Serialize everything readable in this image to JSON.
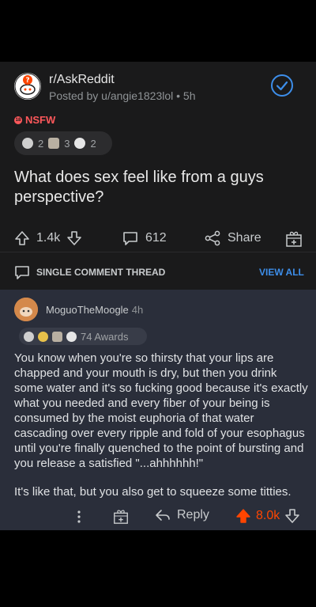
{
  "post": {
    "subreddit": "r/AskReddit",
    "posted_by": "Posted by u/angie1823lol • 5h",
    "nsfw_label": "NSFW",
    "award_counts": [
      "2",
      "3",
      "2"
    ],
    "title": "What does sex feel like from a guys perspective?",
    "votes": "1.4k",
    "comments": "612",
    "share_label": "Share"
  },
  "thread": {
    "label": "SINGLE COMMENT THREAD",
    "view_all": "VIEW ALL"
  },
  "comment": {
    "username": "MoguoTheMoogle",
    "time": "4h",
    "awards_label": "74 Awards",
    "paragraphs": [
      "You know when you're so thirsty that your lips are chapped and your mouth is dry, but then you drink some water and it's so fucking good because it's exactly what you needed and every fiber of your being is consumed by the moist euphoria of that water cascading over every ripple and fold of your esophagus until you're finally quenched to the point of bursting and you release a satisfied \"...ahhhhhh!\"",
      "It's like that, but you also get to squeeze some titties."
    ],
    "reply_label": "Reply",
    "votes": "8.0k"
  },
  "colors": {
    "upvote": "#ff4500",
    "link": "#3d8eea",
    "nsfw": "#ff585b"
  }
}
